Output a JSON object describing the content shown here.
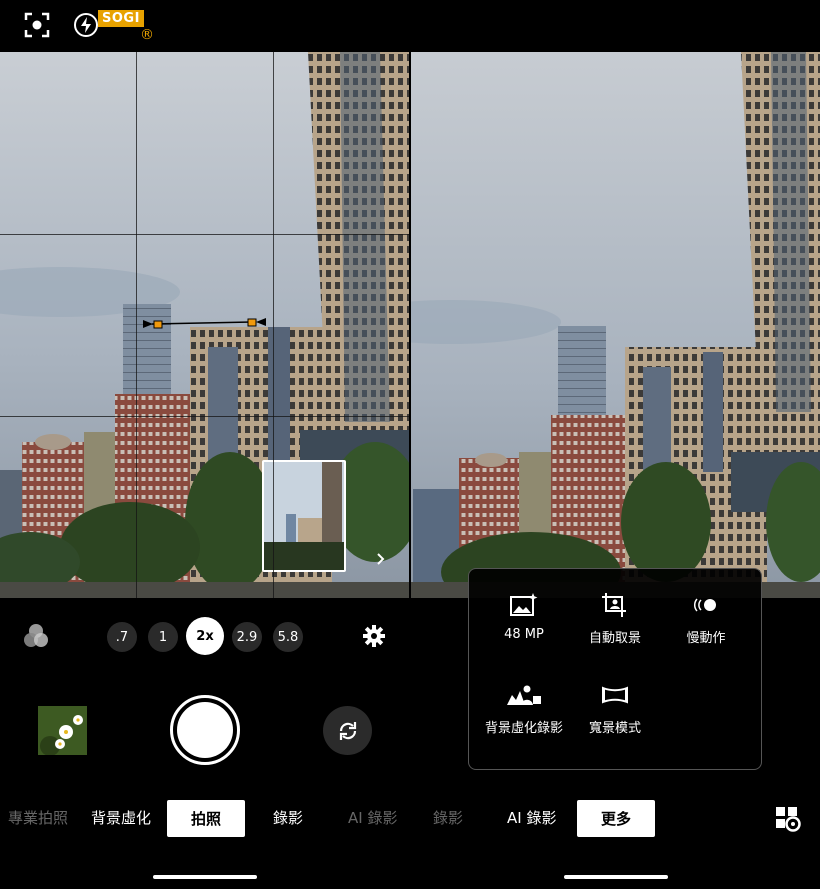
{
  "watermark": {
    "brand": "SOGI",
    "trademark": "®"
  },
  "left_panel": {
    "top_icons": [
      "focus-frame-icon",
      "flash-auto-icon"
    ],
    "zoom_levels": [
      ".7",
      "1",
      "2x",
      "2.9",
      "5.8"
    ],
    "selected_zoom": "2x",
    "icons": [
      "color-filter-icon",
      "settings-gear-icon",
      "gallery-thumbnail",
      "shutter-button",
      "switch-camera-icon"
    ],
    "modes": [
      "專業拍照",
      "背景虛化",
      "拍照",
      "錄影",
      "AI 錄影"
    ],
    "selected_mode": "拍照"
  },
  "right_panel": {
    "more_menu": {
      "items": [
        "48 MP",
        "自動取景",
        "慢動作",
        "背景虛化錄影",
        "寬景模式"
      ]
    },
    "modes": [
      "錄影",
      "AI 錄影",
      "更多"
    ],
    "selected_mode": "更多",
    "corner_icon": "mode-layout-settings-icon"
  },
  "colors": {
    "accent": "#e8a200",
    "background": "#000000",
    "selected_bg": "#ffffff"
  }
}
